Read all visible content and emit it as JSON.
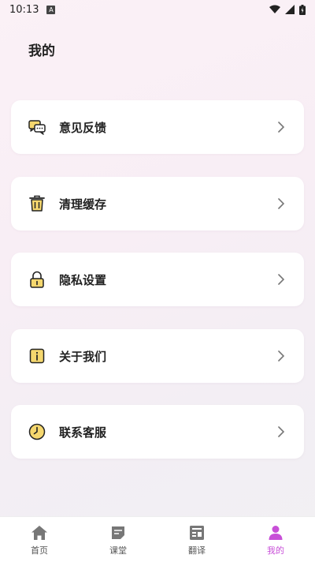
{
  "status_bar": {
    "time": "10:13",
    "notif_icon": "A"
  },
  "page": {
    "title": "我的"
  },
  "menu": [
    {
      "label": "意见反馈",
      "icon": "chat-bubbles-icon"
    },
    {
      "label": "清理缓存",
      "icon": "trash-icon"
    },
    {
      "label": "隐私设置",
      "icon": "lock-icon"
    },
    {
      "label": "关于我们",
      "icon": "info-icon"
    },
    {
      "label": "联系客服",
      "icon": "clock-icon"
    }
  ],
  "tabbar": [
    {
      "label": "首页",
      "icon": "home-icon",
      "active": false
    },
    {
      "label": "课堂",
      "icon": "note-icon",
      "active": false
    },
    {
      "label": "翻译",
      "icon": "translate-icon",
      "active": false
    },
    {
      "label": "我的",
      "icon": "profile-icon",
      "active": true
    }
  ],
  "colors": {
    "accent": "#c84fd8",
    "icon_yellow": "#f5d76e",
    "icon_stroke": "#222222"
  }
}
